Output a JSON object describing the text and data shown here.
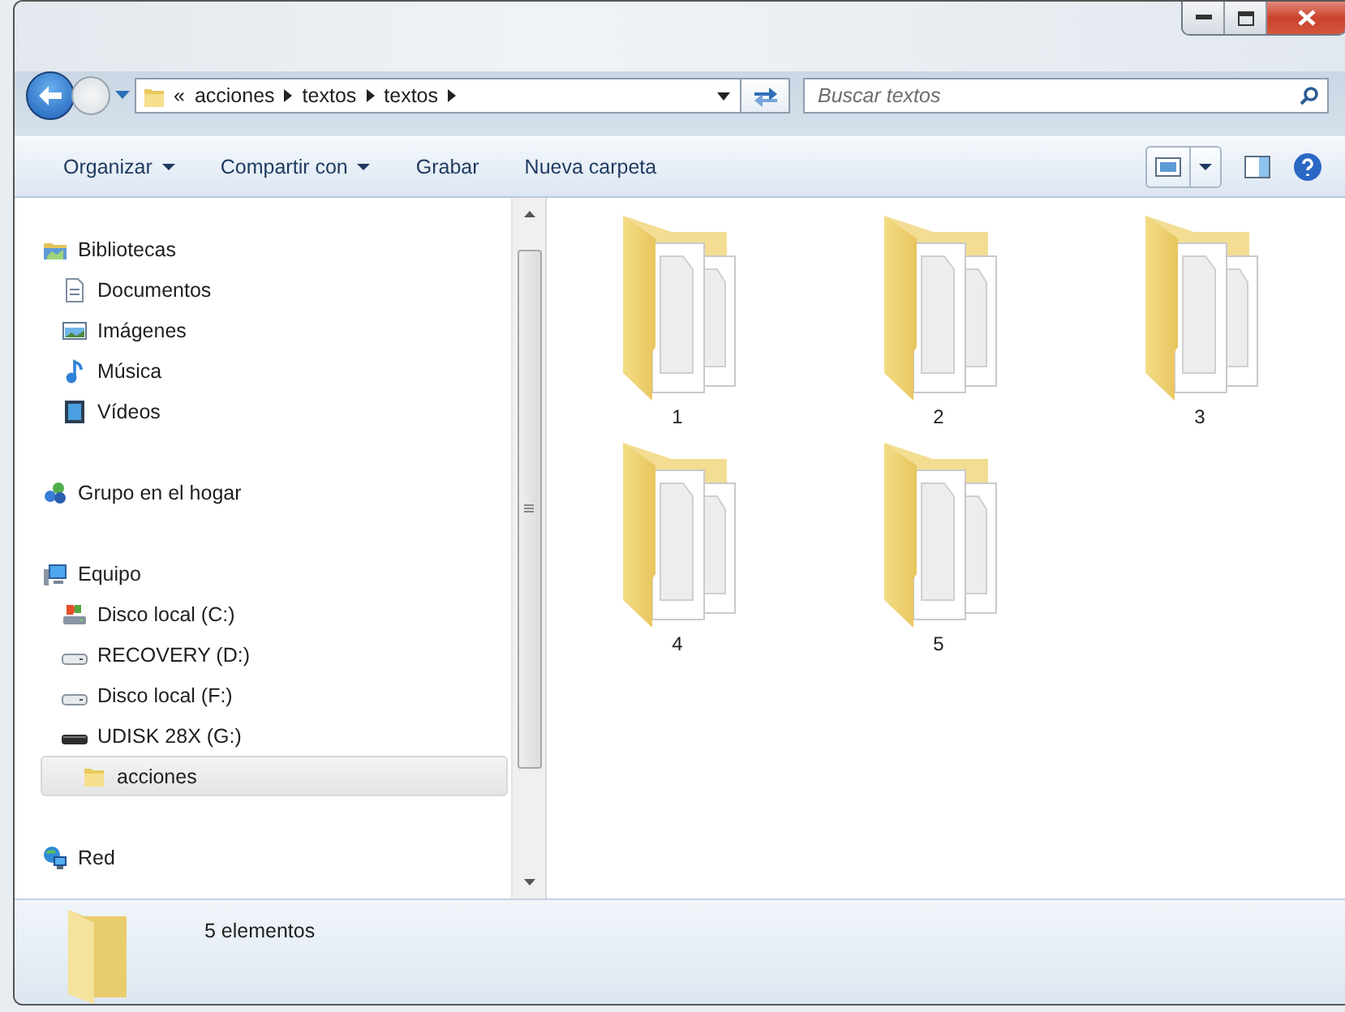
{
  "address": {
    "overflow_mark": "«",
    "segments": [
      "acciones",
      "textos",
      "textos"
    ]
  },
  "search": {
    "placeholder": "Buscar textos"
  },
  "toolbar": [
    {
      "label": "Organizar",
      "dropdown": true
    },
    {
      "label": "Compartir con",
      "dropdown": true
    },
    {
      "label": "Grabar",
      "dropdown": false
    },
    {
      "label": "Nueva carpeta",
      "dropdown": false
    }
  ],
  "navigation": [
    {
      "label": "Bibliotecas",
      "kind": "library",
      "selected": false,
      "children": [
        {
          "label": "Documentos",
          "kind": "documents",
          "selected": false
        },
        {
          "label": "Imágenes",
          "kind": "pictures",
          "selected": false
        },
        {
          "label": "Música",
          "kind": "music",
          "selected": false
        },
        {
          "label": "Vídeos",
          "kind": "videos",
          "selected": false
        }
      ]
    },
    {
      "label": "Grupo en el hogar",
      "kind": "homegroup",
      "selected": false
    },
    {
      "label": "Equipo",
      "kind": "computer",
      "selected": false,
      "children": [
        {
          "label": "Disco local (C:)",
          "kind": "system-drive",
          "selected": false
        },
        {
          "label": "RECOVERY (D:)",
          "kind": "drive",
          "selected": false
        },
        {
          "label": "Disco local (F:)",
          "kind": "drive",
          "selected": false
        },
        {
          "label": "UDISK 28X (G:)",
          "kind": "usb-drive",
          "selected": false,
          "children": [
            {
              "label": "acciones",
              "kind": "folder",
              "selected": true
            }
          ]
        }
      ]
    },
    {
      "label": "Red",
      "kind": "network",
      "selected": false
    }
  ],
  "folders": [
    {
      "name": "1"
    },
    {
      "name": "2"
    },
    {
      "name": "3"
    },
    {
      "name": "4"
    },
    {
      "name": "5"
    }
  ],
  "status_bar": {
    "count": "5 elementos"
  }
}
